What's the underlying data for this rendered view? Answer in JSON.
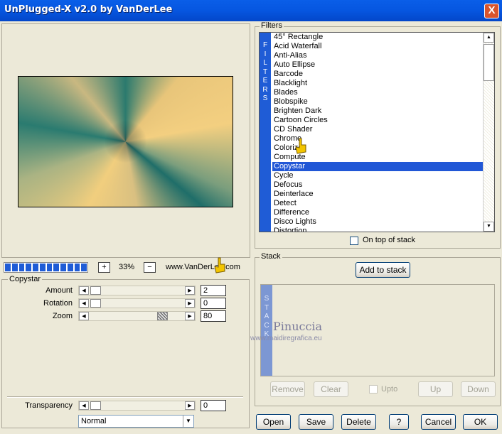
{
  "window": {
    "title": "UnPlugged-X v2.0 by VanDerLee",
    "close_label": "X"
  },
  "preview": {
    "zoom_plus": "+",
    "zoom_value": "33%",
    "zoom_minus": "−",
    "website": "www.VanDerLee.com",
    "progress_segments": 12
  },
  "params": {
    "group_label": "Copystar",
    "items": [
      {
        "label": "Amount",
        "value": "2"
      },
      {
        "label": "Rotation",
        "value": "0"
      },
      {
        "label": "Zoom",
        "value": "80"
      }
    ],
    "transparency": {
      "label": "Transparency",
      "value": "0"
    },
    "blend_mode": "Normal"
  },
  "filters": {
    "group_label": "Filters",
    "band_letters": [
      "F",
      "I",
      "L",
      "T",
      "E",
      "R",
      "S"
    ],
    "items": [
      "45° Rectangle",
      "Acid Waterfall",
      "Anti-Alias",
      "Auto Ellipse",
      "Barcode",
      "Blacklight",
      "Blades",
      "Blobspike",
      "Brighten Dark",
      "Cartoon Circles",
      "CD Shader",
      "Chrome",
      "Colorize",
      "Compute",
      "Copystar",
      "Cycle",
      "Defocus",
      "Deinterlace",
      "Detect",
      "Difference",
      "Disco Lights",
      "Distortion"
    ],
    "selected": "Copystar",
    "on_top_label": "On top of stack"
  },
  "stack": {
    "group_label": "Stack",
    "add_label": "Add to stack",
    "band_letters": [
      "S",
      "T",
      "A",
      "C",
      "K"
    ],
    "buttons": {
      "remove": "Remove",
      "clear": "Clear",
      "upto": "Upto",
      "up": "Up",
      "down": "Down"
    }
  },
  "watermark": {
    "name": "Pinuccia",
    "url": "www.maidiregrafica.eu"
  },
  "footer": {
    "open": "Open",
    "save": "Save",
    "delete": "Delete",
    "help": "?",
    "cancel": "Cancel",
    "ok": "OK"
  }
}
